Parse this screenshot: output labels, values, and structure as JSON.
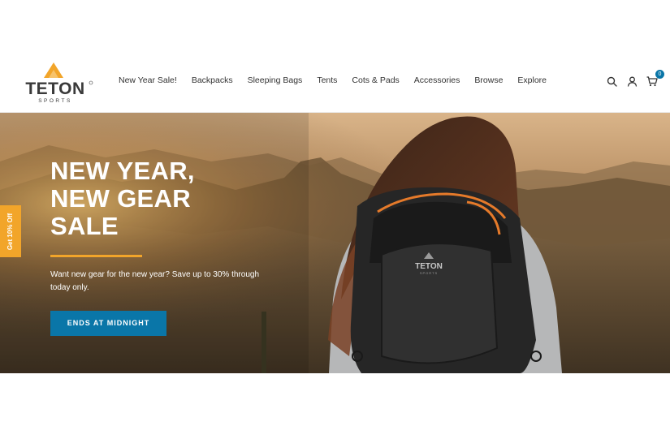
{
  "brand": {
    "name": "TETON",
    "tagline": "SPORTS",
    "accent_color": "#f2a52a",
    "primary_color": "#0a76a8"
  },
  "nav": {
    "items": [
      {
        "label": "New Year Sale!"
      },
      {
        "label": "Backpacks"
      },
      {
        "label": "Sleeping Bags"
      },
      {
        "label": "Tents"
      },
      {
        "label": "Cots & Pads"
      },
      {
        "label": "Accessories"
      },
      {
        "label": "Browse"
      },
      {
        "label": "Explore"
      }
    ]
  },
  "header_icons": {
    "search": "search-icon",
    "account": "user-icon",
    "cart": "cart-icon",
    "cart_count": "0"
  },
  "hero": {
    "title_lines": [
      "NEW YEAR,",
      "NEW GEAR",
      "SALE"
    ],
    "description": "Want new gear for the new year? Save up to 30% through today only.",
    "cta_label": "ENDS AT MIDNIGHT",
    "backpack_brand": "TETON",
    "backpack_sub": "SPORTS"
  },
  "side_tab": {
    "label": "Get 10% Off"
  }
}
